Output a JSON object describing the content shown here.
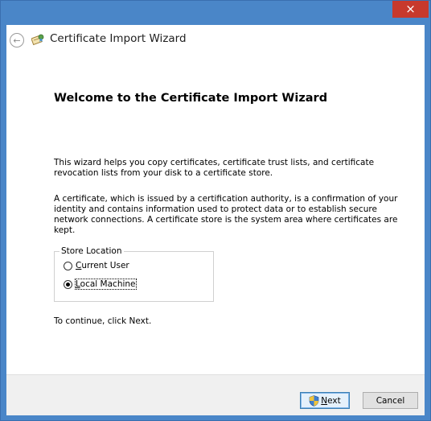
{
  "window": {
    "close_glyph": "×"
  },
  "header": {
    "back_glyph": "←",
    "title": "Certificate Import Wizard"
  },
  "content": {
    "heading": "Welcome to the Certificate Import Wizard",
    "paragraph1": "This wizard helps you copy certificates, certificate trust lists, and certificate revocation lists from your disk to a certificate store.",
    "paragraph2": "A certificate, which is issued by a certification authority, is a confirmation of your identity and contains information used to protect data or to establish secure network connections. A certificate store is the system area where certificates are kept.",
    "store_location": {
      "label": "Store Location",
      "options": [
        {
          "mnemonic": "C",
          "rest": "urrent User",
          "selected": false
        },
        {
          "mnemonic": "L",
          "rest": "ocal Machine",
          "selected": true
        }
      ]
    },
    "continue_text": "To continue, click Next."
  },
  "footer": {
    "next": {
      "mnemonic": "N",
      "rest": "ext"
    },
    "cancel": "Cancel"
  },
  "colors": {
    "titlebar": "#4a86c8",
    "close_button": "#c7392c",
    "footer": "#f0f0f0",
    "default_button_border": "#3c7fb1"
  }
}
